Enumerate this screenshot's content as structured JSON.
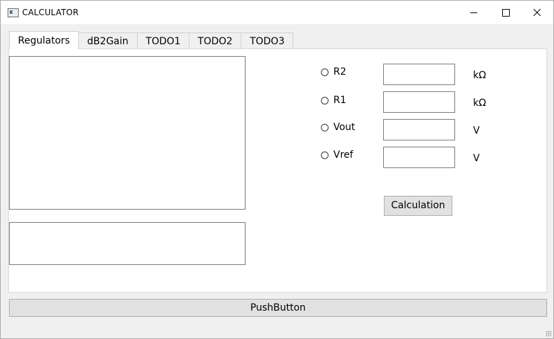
{
  "window": {
    "title": "CALCULATOR"
  },
  "tabs": [
    {
      "label": "Regulators",
      "active": true
    },
    {
      "label": "dB2Gain"
    },
    {
      "label": "TODO1"
    },
    {
      "label": "TODO2"
    },
    {
      "label": "TODO3"
    }
  ],
  "regulators": {
    "rows": [
      {
        "radio_label": "R2",
        "value": "",
        "unit": "kΩ"
      },
      {
        "radio_label": "R1",
        "value": "",
        "unit": "kΩ"
      },
      {
        "radio_label": "Vout",
        "value": "",
        "unit": "V"
      },
      {
        "radio_label": "Vref",
        "value": "",
        "unit": "V"
      }
    ],
    "calculate_label": "Calculation"
  },
  "push_button_label": "PushButton",
  "icons": [
    "app-icon",
    "minimize-icon",
    "maximize-icon",
    "close-icon",
    "resize-grip-icon"
  ]
}
